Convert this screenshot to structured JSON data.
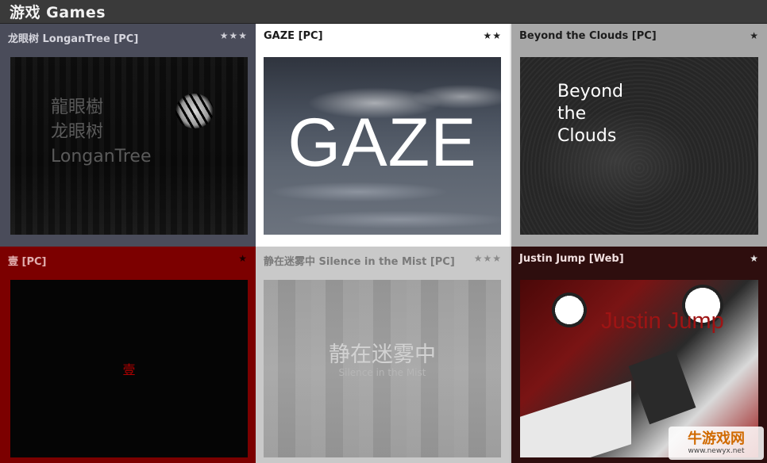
{
  "header": {
    "title": "游戏 Games"
  },
  "games": [
    {
      "title": "龙眼树 LonganTree [PC]",
      "stars": "★★★",
      "thumb_lines": [
        "龍眼樹",
        "龙眼树",
        "LonganTree"
      ]
    },
    {
      "title": "GAZE [PC]",
      "stars": "★★",
      "thumb_text": "GAZE"
    },
    {
      "title": "Beyond the Clouds [PC]",
      "stars": "★",
      "thumb_text": "Beyond\nthe\nClouds"
    },
    {
      "title": "壹 [PC]",
      "stars": "★",
      "thumb_text": "壹"
    },
    {
      "title": "静在迷雾中 Silence in the Mist [PC]",
      "stars": "★★★",
      "thumb_cn": "静在迷雾中",
      "thumb_en": "Silence in the Mist"
    },
    {
      "title": "Justin Jump [Web]",
      "stars": "★",
      "thumb_text": "Justin Jump"
    }
  ],
  "watermark": {
    "logo": "牛游戏网",
    "url": "www.newyx.net"
  }
}
